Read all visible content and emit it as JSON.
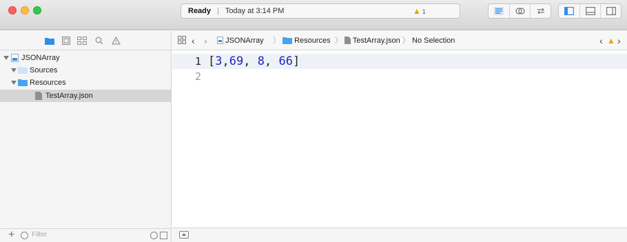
{
  "window": {
    "activity": {
      "status": "Ready",
      "separator": "|",
      "time": "Today at 3:14 PM",
      "warning_count": "1"
    }
  },
  "navigator": {
    "tree": [
      {
        "label": "JSONArray",
        "icon": "project-icon",
        "expanded": true
      },
      {
        "label": "Sources",
        "icon": "folder-icon",
        "expanded": true
      },
      {
        "label": "Resources",
        "icon": "folder-icon",
        "expanded": true
      },
      {
        "label": "TestArray.json",
        "icon": "file-icon",
        "selected": true
      }
    ],
    "filter_placeholder": "Filter"
  },
  "jumpbar": {
    "crumbs": [
      "JSONArray",
      "Resources",
      "TestArray.json",
      "No Selection"
    ]
  },
  "editor": {
    "lines": [
      {
        "number": "1",
        "text": "[3,69, 8, 66]"
      },
      {
        "number": "2",
        "text": ""
      }
    ]
  },
  "colors": {
    "accent": "#2f8fe8",
    "warning": "#e8a400",
    "number_literal": "#1d24c7"
  }
}
